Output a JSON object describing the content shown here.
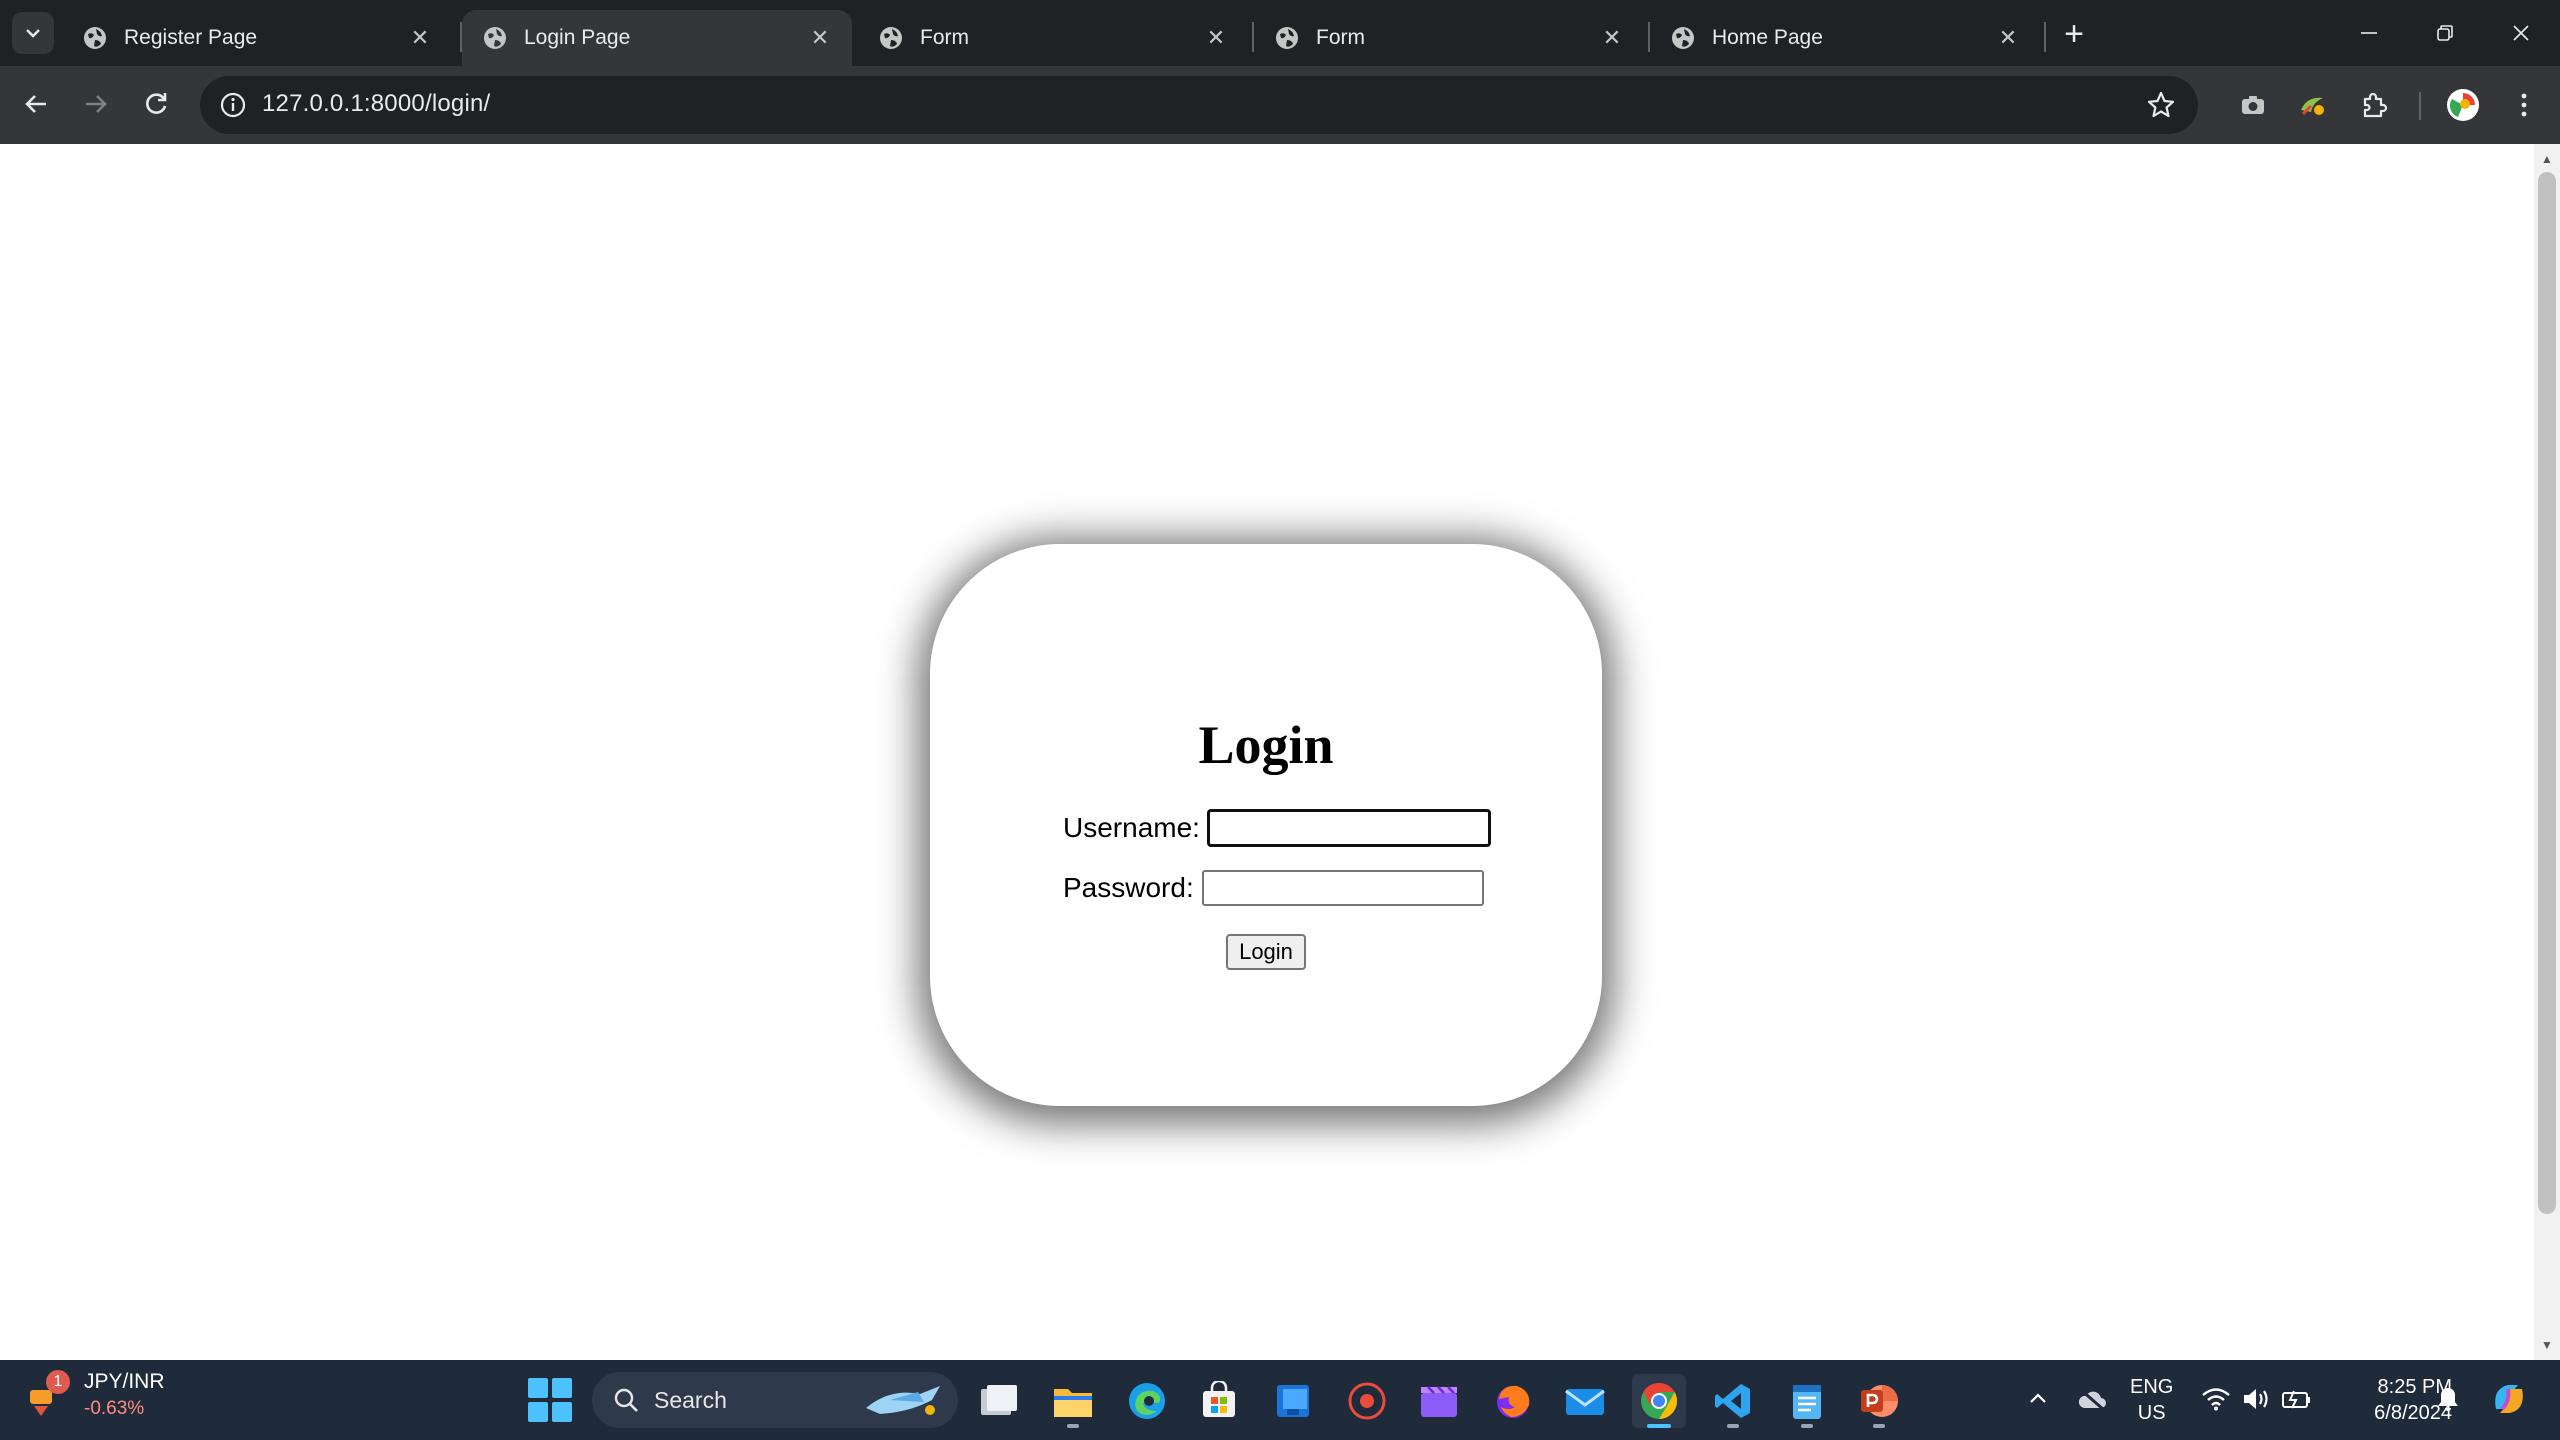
{
  "browser": {
    "tabs": [
      {
        "title": "Register Page",
        "active": false
      },
      {
        "title": "Login Page",
        "active": true
      },
      {
        "title": "Form",
        "active": false
      },
      {
        "title": "Form",
        "active": false
      },
      {
        "title": "Home Page",
        "active": false
      }
    ],
    "close_glyph": "✕",
    "new_tab_glyph": "+",
    "url": "127.0.0.1:8000/login/"
  },
  "page": {
    "heading": "Login",
    "username_label": "Username:",
    "username_value": "",
    "password_label": "Password:",
    "password_value": "",
    "submit_label": "Login"
  },
  "taskbar": {
    "widget": {
      "badge": "1",
      "symbol": "JPY/INR",
      "change": "-0.63%"
    },
    "search_label": "Search",
    "language": {
      "line1": "ENG",
      "line2": "US"
    },
    "clock": {
      "time": "8:25 PM",
      "date": "6/8/2024"
    }
  },
  "colors": {
    "tabstrip_bg": "#202124",
    "toolbar_bg": "#35363a",
    "taskbar_bg": "#1f2a3b",
    "accent": "#4cc2ff",
    "widget_change": "#ff8c82"
  }
}
